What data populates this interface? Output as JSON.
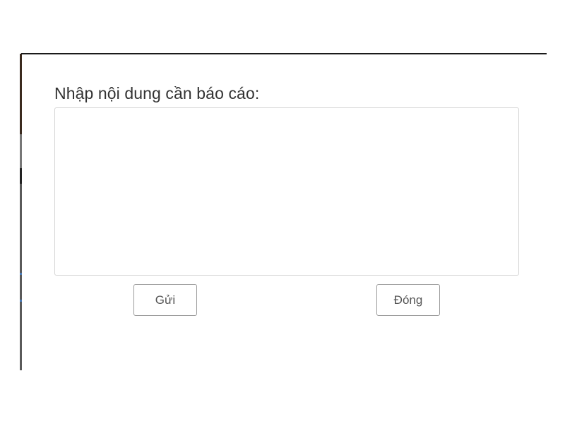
{
  "dialog": {
    "title": "Nhập nội dung cần báo cáo:",
    "textarea": {
      "value": "",
      "placeholder": ""
    },
    "buttons": {
      "send_label": "Gửi",
      "close_label": "Đóng"
    }
  },
  "colors": {
    "title_text": "#333333",
    "border": "#d5d5d5",
    "button_border": "#9a9a9a",
    "button_text": "#555555"
  }
}
